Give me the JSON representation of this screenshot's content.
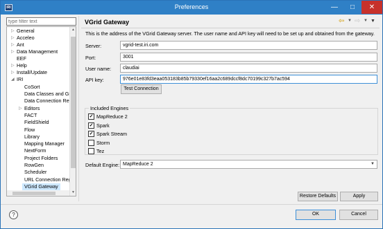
{
  "window": {
    "title": "Preferences",
    "app_icon": "IRI"
  },
  "filter": {
    "placeholder": "type filter text"
  },
  "tree": {
    "items": [
      {
        "label": "General",
        "has_children": true
      },
      {
        "label": "Acceleo",
        "has_children": true
      },
      {
        "label": "Ant",
        "has_children": true
      },
      {
        "label": "Data Management",
        "has_children": true
      },
      {
        "label": "EEF",
        "has_children": false
      },
      {
        "label": "Help",
        "has_children": true
      },
      {
        "label": "Install/Update",
        "has_children": true
      },
      {
        "label": "IRI",
        "has_children": true,
        "expanded": true
      },
      {
        "label": "CoSort",
        "has_children": false
      },
      {
        "label": "Data Classes and Gro",
        "has_children": false
      },
      {
        "label": "Data Connection Re",
        "has_children": false
      },
      {
        "label": "Editors",
        "has_children": true
      },
      {
        "label": "FACT",
        "has_children": false
      },
      {
        "label": "FieldShield",
        "has_children": false
      },
      {
        "label": "Flow",
        "has_children": false
      },
      {
        "label": "Library",
        "has_children": false
      },
      {
        "label": "Mapping Manager",
        "has_children": false
      },
      {
        "label": "NextForm",
        "has_children": false
      },
      {
        "label": "Project Folders",
        "has_children": false
      },
      {
        "label": "RowGen",
        "has_children": false
      },
      {
        "label": "Scheduler",
        "has_children": false
      },
      {
        "label": "URL Connection Reg",
        "has_children": false
      },
      {
        "label": "VGrid Gateway",
        "has_children": false,
        "selected": true
      }
    ]
  },
  "page": {
    "title": "VGrid Gateway",
    "description": "This is the address of the VGrid Gateway server. The user name and API key will need to be set up and obtained from the gateway."
  },
  "form": {
    "server_label": "Server:",
    "server_value": "vgrid-test.iri.com",
    "port_label": "Port:",
    "port_value": "3001",
    "user_label": "User name:",
    "user_value": "claudiai",
    "apikey_label": "API key:",
    "apikey_value": "976e01e83fd3eaa053183b85b79330ef16aa2c689dccf8dc70199c327b7ac594",
    "test_button": "Test Connection"
  },
  "engines": {
    "group_label": "Included Engines",
    "items": [
      {
        "label": "MapReduce 2",
        "checked": true
      },
      {
        "label": "Spark",
        "checked": true
      },
      {
        "label": "Spark Stream",
        "checked": true
      },
      {
        "label": "Storm",
        "checked": false
      },
      {
        "label": "Tez",
        "checked": false
      }
    ]
  },
  "default_engine": {
    "label": "Default Engine:",
    "value": "MapReduce 2"
  },
  "buttons": {
    "restore_defaults": "Restore Defaults",
    "apply": "Apply",
    "ok": "OK",
    "cancel": "Cancel"
  },
  "icons": {
    "help": "help-icon",
    "back": "back-arrow-icon",
    "forward": "forward-arrow-icon",
    "view_menu": "view-menu-icon",
    "minimize": "minimize-icon",
    "maximize": "maximize-icon",
    "close": "close-icon"
  },
  "colors": {
    "titlebar": "#2f80c6",
    "close": "#c7312b",
    "selection": "#cde8ff",
    "focus": "#3c8fd8"
  }
}
